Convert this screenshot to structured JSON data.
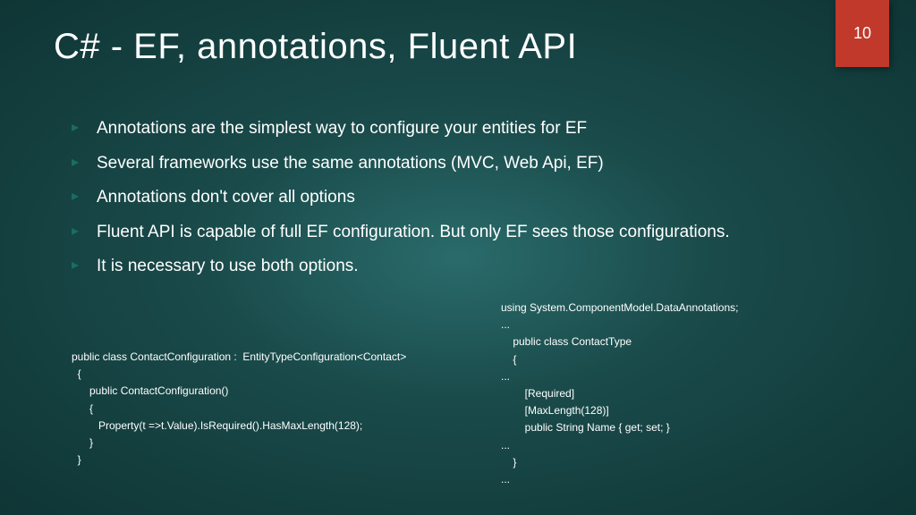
{
  "slide": {
    "number": "10",
    "title": "C# - EF, annotations, Fluent API"
  },
  "bullets": {
    "item1": "Annotations are the simplest way to configure your entities for EF",
    "item2": "Several frameworks use the same annotations (MVC, Web Api, EF)",
    "item3": "Annotations don't cover all options",
    "item4": "Fluent API is capable of full EF configuration. But only EF sees those configurations.",
    "item5": "It is necessary to use both options."
  },
  "code": {
    "left": "public class ContactConfiguration :  EntityTypeConfiguration<Contact>\n  {\n      public ContactConfiguration()\n      {\n         Property(t =>t.Value).IsRequired().HasMaxLength(128);\n      }\n  }",
    "right": "using System.ComponentModel.DataAnnotations;\n...\n    public class ContactType\n    {\n...\n        [Required]\n        [MaxLength(128)]\n        public String Name { get; set; }\n...\n    }\n..."
  }
}
